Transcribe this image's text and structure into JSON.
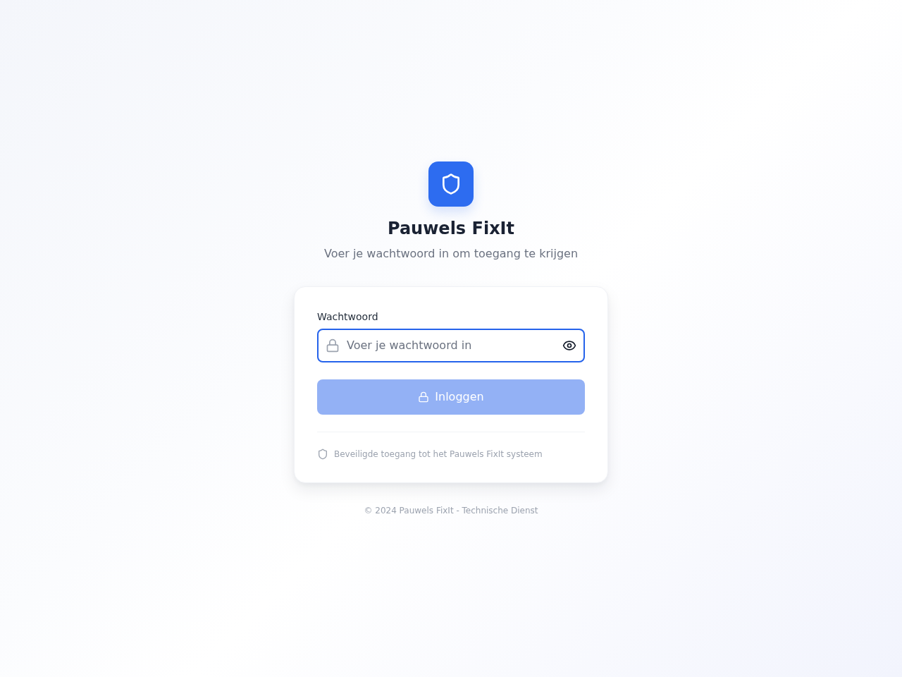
{
  "header": {
    "title": "Pauwels FixIt",
    "subtitle": "Voer je wachtwoord in om toegang te krijgen"
  },
  "form": {
    "password_field": {
      "label": "Wachtwoord",
      "placeholder": "Voer je wachtwoord in",
      "focused": true
    },
    "login_button": {
      "label": "Inloggen",
      "disabled": true
    },
    "security_note": "Beveiligde toegang tot het Pauwels FixIt systeem"
  },
  "footer": {
    "copyright": "© 2024 Pauwels FixIt - Technische Dienst"
  }
}
